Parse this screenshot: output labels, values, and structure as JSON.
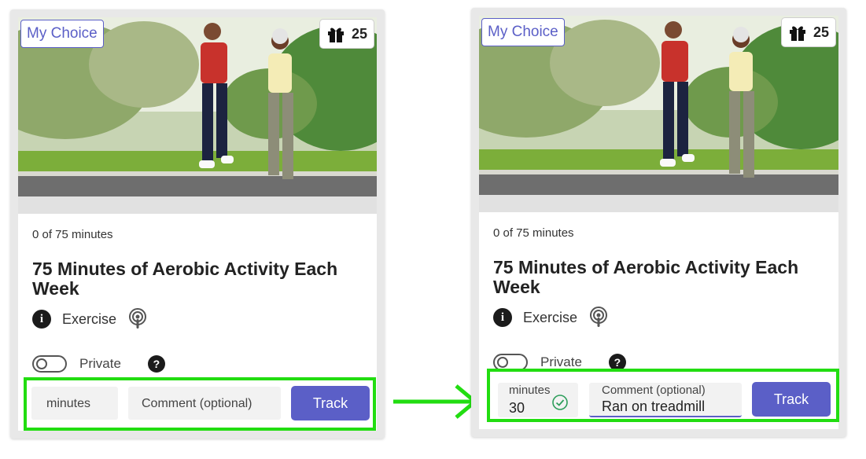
{
  "cards": {
    "before": {
      "badge": "My Choice",
      "points": "25",
      "progress": "0 of 75 minutes",
      "title": "75 Minutes of Aerobic Activity Each Week",
      "category": "Exercise",
      "private_label": "Private",
      "minutes_placeholder": "minutes",
      "comment_placeholder": "Comment (optional)",
      "track_label": "Track"
    },
    "after": {
      "badge": "My Choice",
      "points": "25",
      "progress": "0 of 75 minutes",
      "title": "75 Minutes of Aerobic Activity Each Week",
      "category": "Exercise",
      "private_label": "Private",
      "minutes_label": "minutes",
      "minutes_value": "30",
      "comment_label": "Comment (optional)",
      "comment_value": "Ran on treadmill",
      "track_label": "Track"
    }
  },
  "colors": {
    "accent": "#5b5fc7",
    "highlight": "#22dd11",
    "valid_check": "#2e9e5b"
  },
  "icons": {
    "gift": "gift-icon",
    "info": "info-icon",
    "podcast": "podcast-icon",
    "help": "help-icon",
    "check": "check-circle-icon",
    "arrow": "right-arrow-icon"
  }
}
